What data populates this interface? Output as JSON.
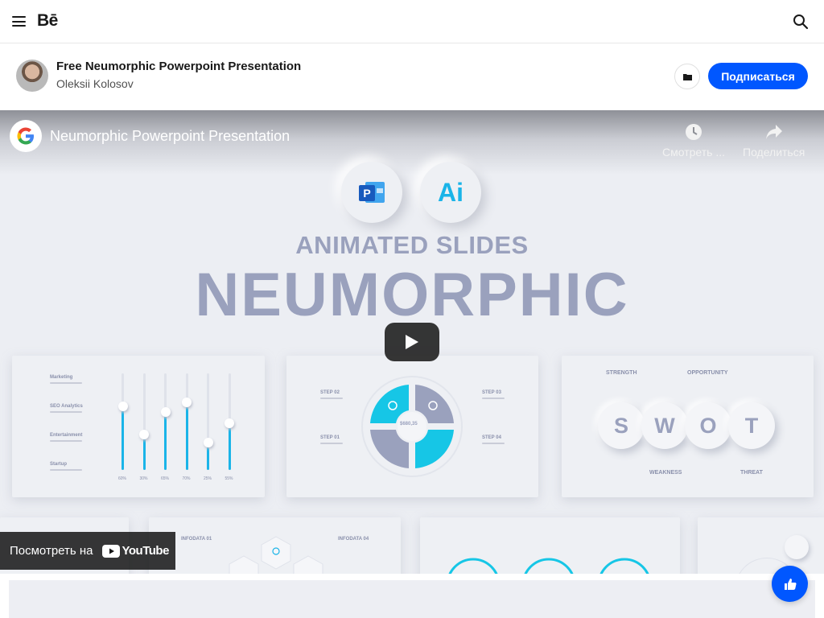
{
  "nav": {
    "logo": "Bē"
  },
  "project": {
    "title": "Free Neumorphic Powerpoint Presentation",
    "author": "Oleksii Kolosov",
    "follow_label": "Подписаться"
  },
  "video": {
    "title": "Neumorphic Powerpoint Presentation",
    "watch_later_label": "Смотреть ...",
    "share_label": "Поделиться",
    "ai_label": "Ai",
    "headline_small": "ANIMATED SLIDES",
    "headline_big": "NEUMORPHIC",
    "watch_on_label": "Посмотреть на",
    "youtube_label": "YouTube",
    "slide1": {
      "rows": [
        "Marketing",
        "SEO Analytics",
        "Entertainment",
        "Startup"
      ],
      "percents": [
        "60%",
        "30%",
        "65%",
        "70%",
        "25%",
        "55%"
      ],
      "levels": [
        0.66,
        0.37,
        0.6,
        0.7,
        0.28,
        0.48
      ]
    },
    "slide2": {
      "steps": [
        "STEP 02",
        "STEP 03",
        "STEP 01",
        "STEP 04"
      ],
      "center_value": "$680,35"
    },
    "slide3": {
      "letters": [
        "S",
        "W",
        "O",
        "T"
      ],
      "labels": [
        "STRENGTH",
        "OPPORTUNITY",
        "WEAKNESS",
        "THREAT"
      ]
    },
    "slide4": {
      "labels": [
        "INFODATA 01",
        "INFODATA 04"
      ]
    }
  },
  "colors": {
    "accent": "#0057ff",
    "brand_cyan": "#1ab4e8",
    "headline": "#9aa1bd"
  }
}
